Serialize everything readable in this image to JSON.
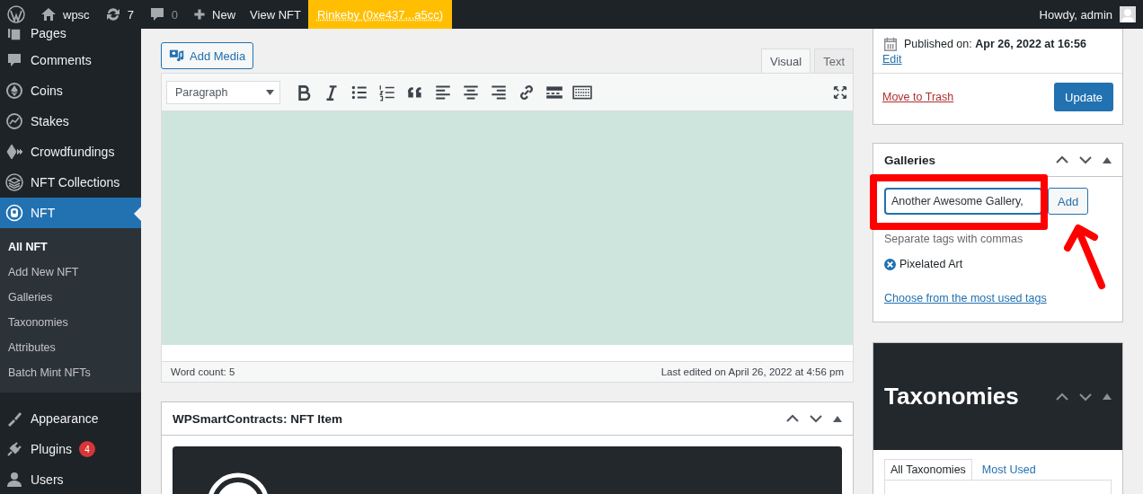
{
  "admin_bar": {
    "site": "wpsc",
    "updates": "7",
    "comments": "0",
    "new": "New",
    "view": "View NFT",
    "network": "Rinkeby (0xe437...a5cc)",
    "greeting": "Howdy, admin"
  },
  "sidebar": {
    "items": [
      {
        "label": "Pages",
        "selected": false
      },
      {
        "label": "Comments",
        "selected": false
      },
      {
        "label": "Coins",
        "selected": false
      },
      {
        "label": "Stakes",
        "selected": false
      },
      {
        "label": "Crowdfundings",
        "selected": false
      },
      {
        "label": "NFT Collections",
        "selected": false
      },
      {
        "label": "NFT",
        "selected": true,
        "children": [
          {
            "label": "All NFT",
            "selected": true
          },
          {
            "label": "Add New NFT",
            "selected": false
          },
          {
            "label": "Galleries",
            "selected": false
          },
          {
            "label": "Taxonomies",
            "selected": false
          },
          {
            "label": "Attributes",
            "selected": false
          },
          {
            "label": "Batch Mint NFTs",
            "selected": false
          }
        ]
      },
      {
        "label": "Appearance",
        "selected": false
      },
      {
        "label": "Plugins",
        "selected": false,
        "badge": "4"
      },
      {
        "label": "Users",
        "selected": false
      }
    ]
  },
  "editor": {
    "add_media": "Add Media",
    "tabs": [
      {
        "label": "Visual",
        "selected": true
      },
      {
        "label": "Text",
        "selected": false
      }
    ],
    "format": "Paragraph",
    "word_count": "Word count: 5",
    "last_edited": "Last edited on April 26, 2022 at 4:56 pm"
  },
  "nft_item_box": {
    "title": "WPSmartContracts: NFT Item"
  },
  "publish": {
    "published": "Published on: **Apr 26, 2022 at 16:56**",
    "edit": "Edit",
    "trash": "Move to Trash",
    "update": "Update"
  },
  "galleries": {
    "title": "Galleries",
    "value": "Another Awesome Gallery,",
    "add": "Add",
    "hint": "Separate tags with commas",
    "tags": [
      "Pixelated Art"
    ],
    "most_used_link": "Choose from the most used tags"
  },
  "taxonomies": {
    "title": "Taxonomies",
    "tabs": [
      {
        "label": "All Taxonomies",
        "selected": true
      },
      {
        "label": "Most Used",
        "selected": false
      }
    ]
  }
}
